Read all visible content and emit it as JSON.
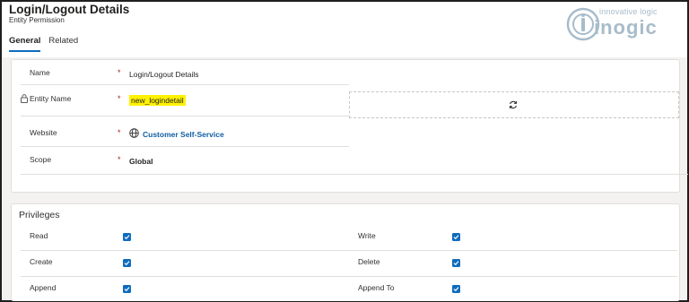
{
  "header": {
    "title": "Login/Logout Details",
    "subtitle": "Entity Permission",
    "tabs": [
      {
        "label": "General",
        "active": true
      },
      {
        "label": "Related",
        "active": false
      }
    ]
  },
  "logo": {
    "tagline": "innovative logic",
    "name": "inogic",
    "icon": "inogic-logo-icon"
  },
  "general": {
    "fields": [
      {
        "label": "Name",
        "required": "*",
        "value": "Login/Logout Details"
      },
      {
        "label": "Entity Name",
        "required": "*",
        "value": "new_logindetail",
        "icon": "lock-icon"
      },
      {
        "label": "Website",
        "required": "*",
        "value": "Customer Self-Service",
        "icon": "globe-icon"
      },
      {
        "label": "Scope",
        "required": "*",
        "value": "Global"
      }
    ],
    "loading_icon": "refresh-icon"
  },
  "privileges": {
    "title": "Privileges",
    "items": [
      {
        "label": "Read",
        "checked": true
      },
      {
        "label": "Write",
        "checked": true
      },
      {
        "label": "Create",
        "checked": true
      },
      {
        "label": "Delete",
        "checked": true
      },
      {
        "label": "Append",
        "checked": true
      },
      {
        "label": "Append To",
        "checked": true
      }
    ]
  },
  "colors": {
    "accent": "#0f6cbd",
    "required": "#a4262c",
    "highlight": "#fff200",
    "link": "#115ea3"
  }
}
